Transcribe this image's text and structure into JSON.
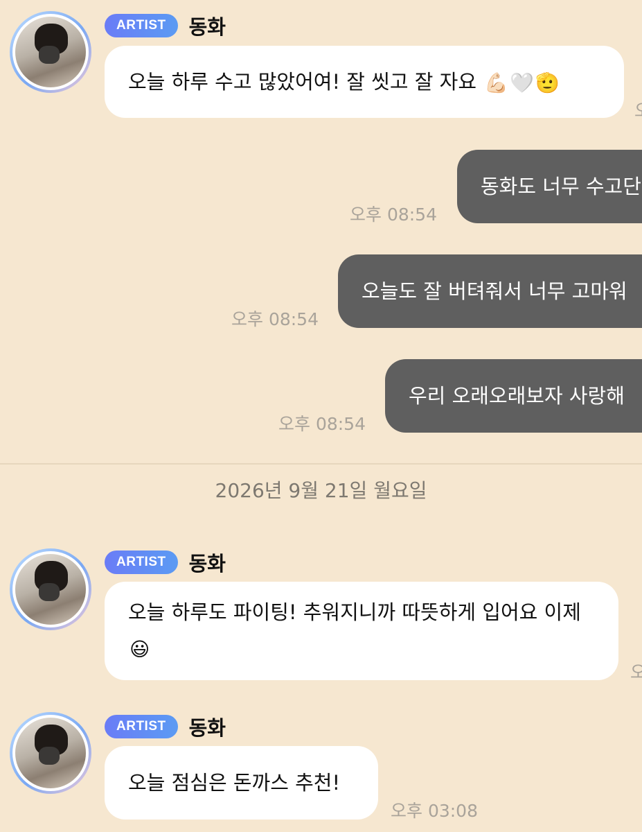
{
  "messages": [
    {
      "badge": "ARTIST",
      "sender": "동화",
      "text": "오늘 하루 수고 많았어여! 잘 씻고 잘 자요",
      "emojis": [
        "💪🏻",
        "🤍",
        "🫡"
      ],
      "time": "오"
    },
    {
      "text": "동화도 너무 수고단",
      "time": "오후 08:54"
    },
    {
      "text": "오늘도 잘 버텨줘서 너무 고마워",
      "time": "오후 08:54"
    },
    {
      "text": "우리 오래오래보자 사랑해",
      "time": "오후 08:54"
    },
    {
      "badge": "ARTIST",
      "sender": "동화",
      "text": "오늘 하루도 파이팅! 추워지니까 따뜻하게 입어요 이제",
      "emojis": [
        "😃"
      ],
      "time": "오"
    },
    {
      "badge": "ARTIST",
      "sender": "동화",
      "text": "오늘 점심은 돈까스 추천!",
      "time": "오후 03:08"
    }
  ],
  "date_separator": "2026년 9월 21일 월요일",
  "colors": {
    "background": "#f6e7d0",
    "incoming_bubble": "#ffffff",
    "outgoing_bubble": "#5f5f5f",
    "badge_gradient_start": "#6a7cf6",
    "badge_gradient_end": "#5b9bf3",
    "timestamp": "#a9a39a"
  }
}
